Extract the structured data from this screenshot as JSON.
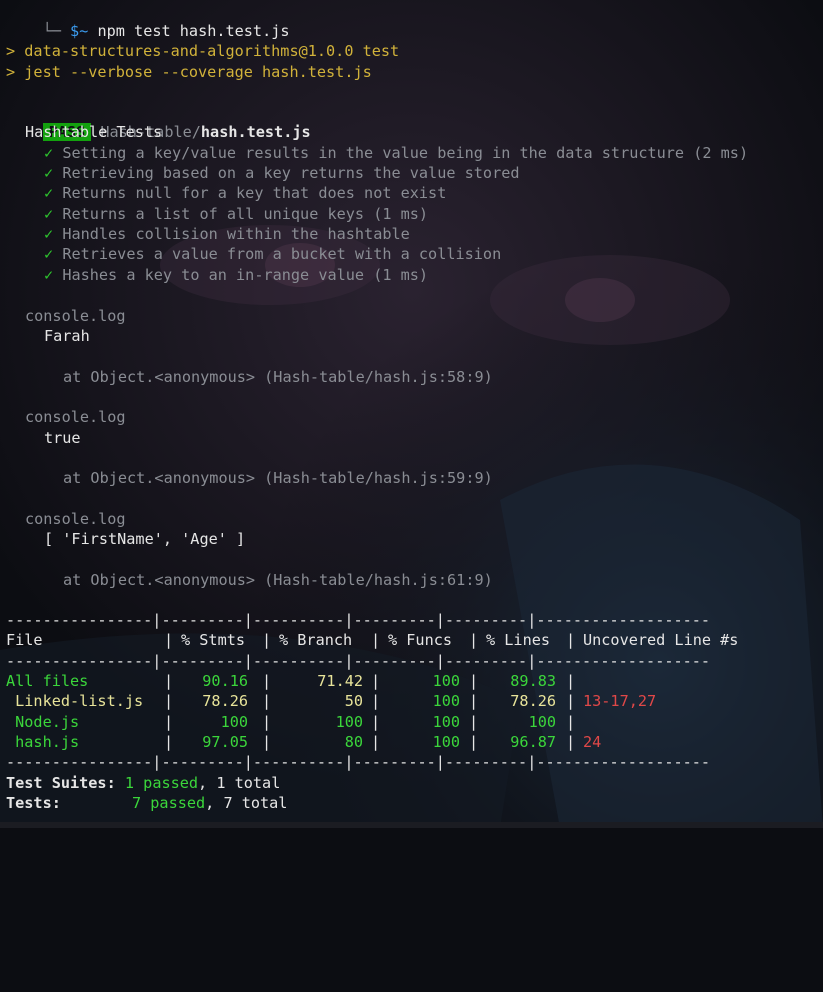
{
  "prompt": {
    "branch_glyph": "└─",
    "symbol": "$~",
    "command": "npm test hash.test.js"
  },
  "npm": {
    "line1": "> data-structures-and-algorithms@1.0.0 test",
    "line2": "> jest --verbose --coverage hash.test.js"
  },
  "result": {
    "badge": "PASS",
    "dir": "Hash-table/",
    "file": "hash.test.js"
  },
  "suite": {
    "title": "Hashtable Tests",
    "check": "✓",
    "tests": [
      "Setting a key/value results in the value being in the data structure (2 ms)",
      "Retrieving based on a key returns the value stored",
      "Returns null for a key that does not exist",
      "Returns a list of all unique keys (1 ms)",
      "Handles collision within the hashtable",
      "Retrieves a value from a bucket with a collision",
      "Hashes a key to an in-range value (1 ms)"
    ]
  },
  "logs": [
    {
      "label": "console.log",
      "value": "Farah",
      "location": "at Object.<anonymous> (Hash-table/hash.js:58:9)"
    },
    {
      "label": "console.log",
      "value": "true",
      "location": "at Object.<anonymous> (Hash-table/hash.js:59:9)"
    },
    {
      "label": "console.log",
      "value": "[ 'FirstName', 'Age' ]",
      "location": "at Object.<anonymous> (Hash-table/hash.js:61:9)"
    }
  ],
  "coverage": {
    "separator": "----------------|---------|----------|---------|---------|-------------------",
    "headers": [
      "File",
      "% Stmts",
      "% Branch",
      "% Funcs",
      "% Lines",
      "Uncovered Line #s"
    ],
    "rows": [
      {
        "file": "All files",
        "stmts": "90.16",
        "branch": "71.42",
        "funcs": "100",
        "lines": "89.83",
        "uncovered": ""
      },
      {
        "file": " Linked-list.js",
        "stmts": "78.26",
        "branch": "50",
        "funcs": "100",
        "lines": "78.26",
        "uncovered": "13-17,27"
      },
      {
        "file": " Node.js",
        "stmts": "100",
        "branch": "100",
        "funcs": "100",
        "lines": "100",
        "uncovered": ""
      },
      {
        "file": " hash.js",
        "stmts": "97.05",
        "branch": "80",
        "funcs": "100",
        "lines": "96.87",
        "uncovered": "24"
      }
    ]
  },
  "summary": {
    "suites_label": "Test Suites:",
    "suites_passed": "1 passed",
    "suites_total": ", 1 total",
    "tests_label": "Tests:",
    "tests_passed": "7 passed",
    "tests_total": ", 7 total"
  }
}
